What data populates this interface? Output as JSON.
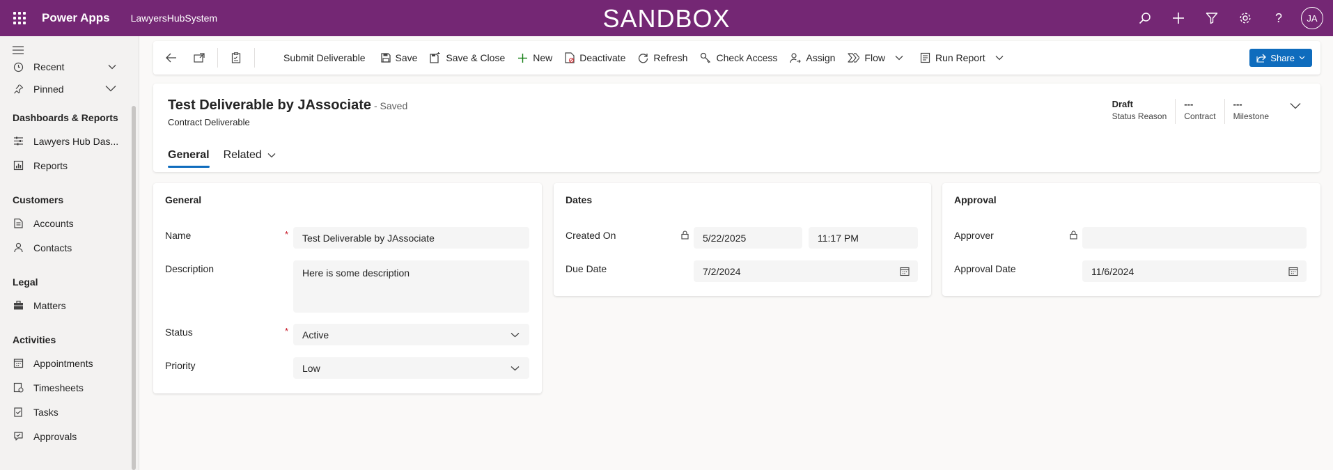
{
  "topbar": {
    "app_name": "Power Apps",
    "env_name": "LawyersHubSystem",
    "banner": "SANDBOX",
    "avatar_initials": "JA",
    "color": "#742774"
  },
  "sidebar": {
    "items": [
      {
        "label": "Recent",
        "icon": "clock-icon",
        "expandable": true
      },
      {
        "label": "Pinned",
        "icon": "pin-icon",
        "expandable": true
      }
    ],
    "groups": [
      {
        "title": "Dashboards & Reports",
        "items": [
          {
            "label": "Lawyers Hub Das...",
            "icon": "dashboard-icon"
          },
          {
            "label": "Reports",
            "icon": "report-icon"
          }
        ]
      },
      {
        "title": "Customers",
        "items": [
          {
            "label": "Accounts",
            "icon": "account-icon"
          },
          {
            "label": "Contacts",
            "icon": "contact-icon"
          }
        ]
      },
      {
        "title": "Legal",
        "items": [
          {
            "label": "Matters",
            "icon": "briefcase-icon"
          }
        ]
      },
      {
        "title": "Activities",
        "items": [
          {
            "label": "Appointments",
            "icon": "calendar-icon"
          },
          {
            "label": "Timesheets",
            "icon": "timesheet-icon"
          },
          {
            "label": "Tasks",
            "icon": "task-icon"
          },
          {
            "label": "Approvals",
            "icon": "approval-icon"
          }
        ]
      }
    ]
  },
  "commands": {
    "submit": "Submit Deliverable",
    "save": "Save",
    "save_close": "Save & Close",
    "new": "New",
    "deactivate": "Deactivate",
    "refresh": "Refresh",
    "check_access": "Check Access",
    "assign": "Assign",
    "flow": "Flow",
    "run_report": "Run Report",
    "share": "Share"
  },
  "record": {
    "title": "Test Deliverable by JAssociate",
    "saved": "- Saved",
    "entity": "Contract Deliverable",
    "header_fields": [
      {
        "value": "Draft",
        "label": "Status Reason"
      },
      {
        "value": "---",
        "label": "Contract"
      },
      {
        "value": "---",
        "label": "Milestone"
      }
    ],
    "tabs": [
      "General",
      "Related"
    ]
  },
  "general": {
    "title": "General",
    "name_label": "Name",
    "name_value": "Test Deliverable by JAssociate",
    "description_label": "Description",
    "description_value": "Here is some description",
    "status_label": "Status",
    "status_value": "Active",
    "priority_label": "Priority",
    "priority_value": "Low"
  },
  "dates": {
    "title": "Dates",
    "created_label": "Created On",
    "created_date": "5/22/2025",
    "created_time": "11:17 PM",
    "due_label": "Due Date",
    "due_value": "7/2/2024"
  },
  "approval": {
    "title": "Approval",
    "approver_label": "Approver",
    "approver_value": "",
    "approval_date_label": "Approval Date",
    "approval_date_value": "11/6/2024"
  },
  "colors": {
    "accent": "#0f6cbd",
    "required": "#c50f1f"
  }
}
